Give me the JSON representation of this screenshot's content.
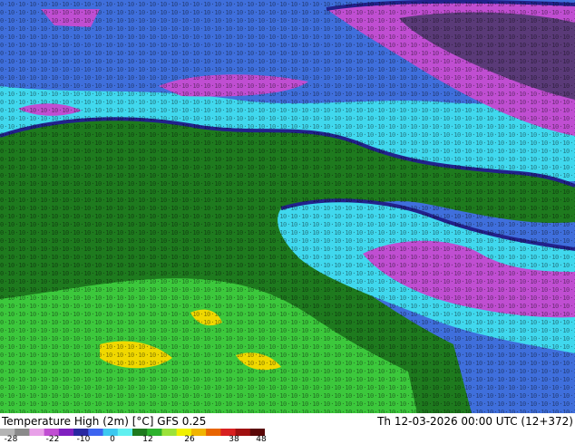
{
  "map": {
    "title": "Temperature High (2m) [°C] GFS 0.25",
    "valid_time": "Th 12-03-2026 00:00 UTC (12+372)",
    "colorbar": {
      "ticks": [
        "-28",
        "-22",
        "-10",
        "0",
        "12",
        "26",
        "38",
        "48"
      ],
      "colors": [
        "#b4b4b4",
        "#8a8a8a",
        "#e8a0e8",
        "#c04ed2",
        "#8020c0",
        "#2828a0",
        "#3c64f0",
        "#3cc8f0",
        "#60f0f0",
        "#1e7a1e",
        "#2db22d",
        "#9be23a",
        "#f0f000",
        "#f0b400",
        "#e86400",
        "#d82020",
        "#a01010",
        "#5a0808"
      ]
    },
    "palette": {
      "ocean_north": "#3f6fdc",
      "ice_magenta": "#c04ed2",
      "cold_core": "#5a3a78",
      "land_green": "#1e7a1e",
      "cyan": "#40d8ee",
      "light_green": "#3cc83c",
      "yellow": "#f0d800",
      "navy": "#22228c"
    }
  }
}
